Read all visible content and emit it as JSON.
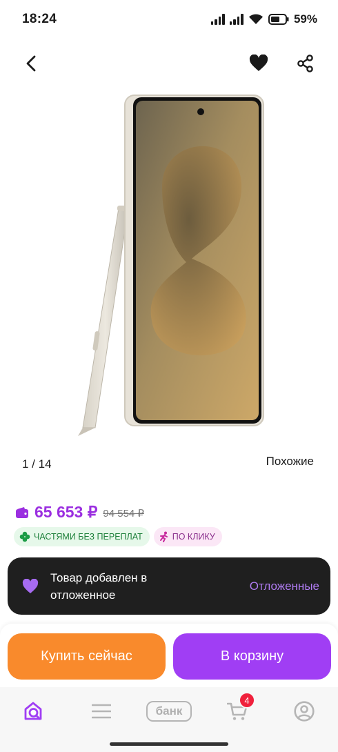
{
  "status_bar": {
    "time": "18:24",
    "battery": "59%"
  },
  "product": {
    "gallery_counter": "1 / 14",
    "similar_link": "Похожие",
    "price": "65 653 ₽",
    "old_price": "94 554 ₽",
    "badges": [
      {
        "label": "ЧАСТЯМИ БЕЗ ПЕРЕПЛАТ",
        "icon": "clover-icon"
      },
      {
        "label": "ПО КЛИКУ",
        "icon": "running-person-icon"
      }
    ]
  },
  "snackbar": {
    "message": "Товар добавлен в отложенное",
    "action": "Отложенные"
  },
  "actions": {
    "buy_now": "Купить сейчас",
    "add_to_cart": "В корзину"
  },
  "bottom_nav": {
    "bank_label": "банк",
    "cart_count": "4"
  },
  "colors": {
    "accent": "#9b2fe0",
    "buy_button": "#f98a2c",
    "cart_button": "#a03ef4",
    "snackbar_bg": "#1f1f1f"
  }
}
